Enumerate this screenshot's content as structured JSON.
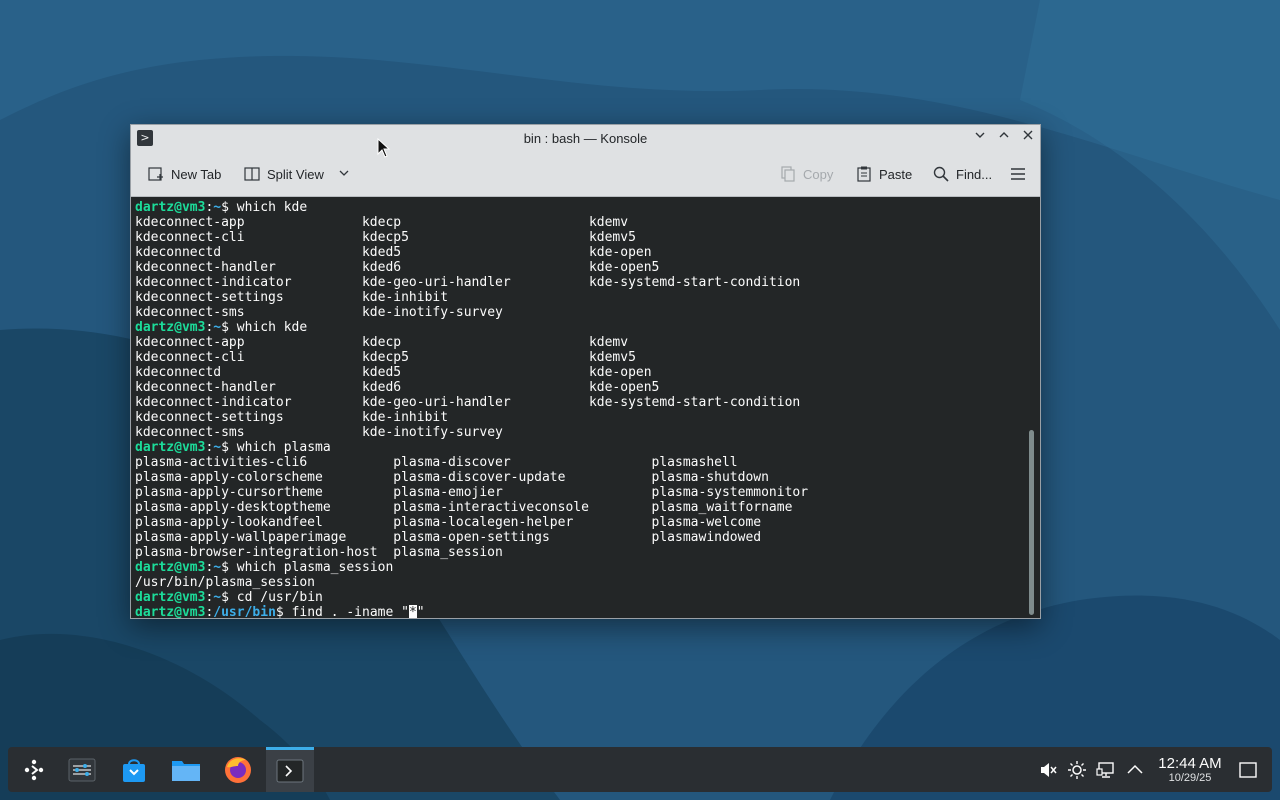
{
  "window": {
    "title": "bin : bash — Konsole",
    "app_icon": "terminal-icon",
    "controls": [
      "minimize-icon",
      "maximize-icon",
      "close-icon"
    ]
  },
  "toolbar": {
    "new_tab": "New Tab",
    "split_view": "Split View",
    "copy": "Copy",
    "paste": "Paste",
    "find": "Find...",
    "menu_icon": "hamburger-menu-icon"
  },
  "terminal": {
    "prompt_user": "dartz@vm3",
    "home_path": "~",
    "bin_path": "/usr/bin",
    "lines": [
      {
        "type": "prompt",
        "path": "~",
        "cmd": "which kde"
      },
      {
        "type": "cols",
        "w": [
          29,
          29
        ],
        "cells": [
          "kdeconnect-app",
          "kdecp",
          "kdemv"
        ]
      },
      {
        "type": "cols",
        "w": [
          29,
          29
        ],
        "cells": [
          "kdeconnect-cli",
          "kdecp5",
          "kdemv5"
        ]
      },
      {
        "type": "cols",
        "w": [
          29,
          29
        ],
        "cells": [
          "kdeconnectd",
          "kded5",
          "kde-open"
        ]
      },
      {
        "type": "cols",
        "w": [
          29,
          29
        ],
        "cells": [
          "kdeconnect-handler",
          "kded6",
          "kde-open5"
        ]
      },
      {
        "type": "cols",
        "w": [
          29,
          29
        ],
        "cells": [
          "kdeconnect-indicator",
          "kde-geo-uri-handler",
          "kde-systemd-start-condition"
        ]
      },
      {
        "type": "cols",
        "w": [
          29,
          29
        ],
        "cells": [
          "kdeconnect-settings",
          "kde-inhibit",
          ""
        ]
      },
      {
        "type": "cols",
        "w": [
          29,
          29
        ],
        "cells": [
          "kdeconnect-sms",
          "kde-inotify-survey",
          ""
        ]
      },
      {
        "type": "prompt",
        "path": "~",
        "cmd": "which kde"
      },
      {
        "type": "cols",
        "w": [
          29,
          29
        ],
        "cells": [
          "kdeconnect-app",
          "kdecp",
          "kdemv"
        ]
      },
      {
        "type": "cols",
        "w": [
          29,
          29
        ],
        "cells": [
          "kdeconnect-cli",
          "kdecp5",
          "kdemv5"
        ]
      },
      {
        "type": "cols",
        "w": [
          29,
          29
        ],
        "cells": [
          "kdeconnectd",
          "kded5",
          "kde-open"
        ]
      },
      {
        "type": "cols",
        "w": [
          29,
          29
        ],
        "cells": [
          "kdeconnect-handler",
          "kded6",
          "kde-open5"
        ]
      },
      {
        "type": "cols",
        "w": [
          29,
          29
        ],
        "cells": [
          "kdeconnect-indicator",
          "kde-geo-uri-handler",
          "kde-systemd-start-condition"
        ]
      },
      {
        "type": "cols",
        "w": [
          29,
          29
        ],
        "cells": [
          "kdeconnect-settings",
          "kde-inhibit",
          ""
        ]
      },
      {
        "type": "cols",
        "w": [
          29,
          29
        ],
        "cells": [
          "kdeconnect-sms",
          "kde-inotify-survey",
          ""
        ]
      },
      {
        "type": "prompt",
        "path": "~",
        "cmd": "which plasma"
      },
      {
        "type": "cols",
        "w": [
          33,
          33
        ],
        "cells": [
          "plasma-activities-cli6",
          "plasma-discover",
          "plasmashell"
        ]
      },
      {
        "type": "cols",
        "w": [
          33,
          33
        ],
        "cells": [
          "plasma-apply-colorscheme",
          "plasma-discover-update",
          "plasma-shutdown"
        ]
      },
      {
        "type": "cols",
        "w": [
          33,
          33
        ],
        "cells": [
          "plasma-apply-cursortheme",
          "plasma-emojier",
          "plasma-systemmonitor"
        ]
      },
      {
        "type": "cols",
        "w": [
          33,
          33
        ],
        "cells": [
          "plasma-apply-desktoptheme",
          "plasma-interactiveconsole",
          "plasma_waitforname"
        ]
      },
      {
        "type": "cols",
        "w": [
          33,
          33
        ],
        "cells": [
          "plasma-apply-lookandfeel",
          "plasma-localegen-helper",
          "plasma-welcome"
        ]
      },
      {
        "type": "cols",
        "w": [
          33,
          33
        ],
        "cells": [
          "plasma-apply-wallpaperimage",
          "plasma-open-settings",
          "plasmawindowed"
        ]
      },
      {
        "type": "cols",
        "w": [
          33,
          33
        ],
        "cells": [
          "plasma-browser-integration-host",
          "plasma_session",
          ""
        ]
      },
      {
        "type": "prompt",
        "path": "~",
        "cmd": "which plasma_session"
      },
      {
        "type": "text",
        "text": "/usr/bin/plasma_session"
      },
      {
        "type": "prompt",
        "path": "~",
        "cmd": "cd /usr/bin"
      },
      {
        "type": "current",
        "path": "/usr/bin",
        "cmd_before": "find . -iname \"*",
        "cursor_char": "*",
        "cmd_after": "\""
      }
    ]
  },
  "taskbar": {
    "apps": [
      "app-launcher-icon",
      "system-settings-icon",
      "discover-store-icon",
      "dolphin-file-manager-icon",
      "firefox-icon",
      "konsole-icon"
    ],
    "tray": [
      "volume-muted-icon",
      "brightness-icon",
      "network-icon",
      "show-hidden-icons-chevron-icon"
    ],
    "clock_time": "12:44 AM",
    "clock_date": "10/29/25",
    "show_desktop_icon": "show-desktop-icon"
  }
}
